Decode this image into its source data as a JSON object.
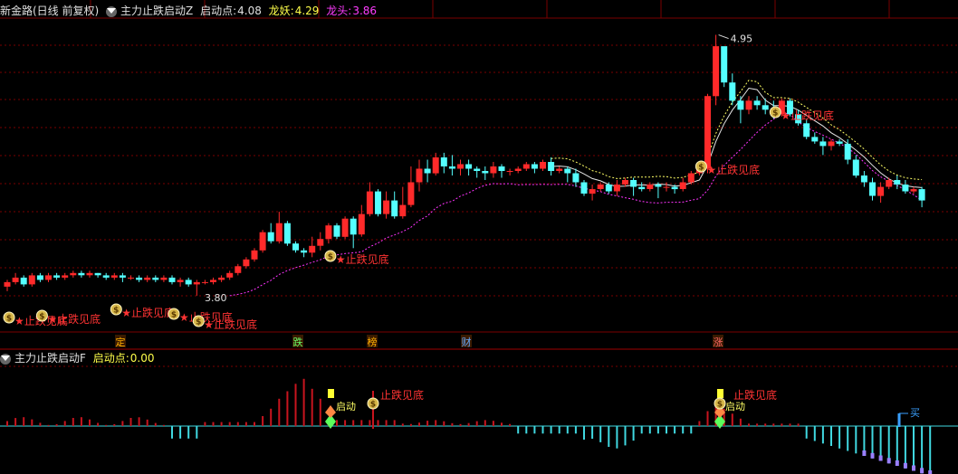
{
  "top_header": {
    "stock": "新金路(日线 前复权)",
    "indicator": "主力止跌启动Z",
    "qd_label": "启动点:",
    "qd_value": "4.08",
    "ly_label": "龙妖:",
    "ly_value": "4.29",
    "lt_label": "龙头:",
    "lt_value": "3.86"
  },
  "bottom_header": {
    "indicator": "主力止跌启动F",
    "qd_label": "启动点:",
    "qd_value": "0.00"
  },
  "price_labels": {
    "high": "4.95",
    "low": "3.80"
  },
  "event_tags": [
    "定",
    "跌",
    "榜",
    "财",
    "涨"
  ],
  "signal_labels": {
    "top": "★止跌见底",
    "bottom": "止跌见底",
    "start": "启动",
    "buy": "买"
  },
  "colors": {
    "up": "#ff2a2a",
    "down": "#54ffff",
    "ma_white": "#e6e6e6",
    "ma_yellow": "#ffff66",
    "ma_magenta": "#ff33ff",
    "grid": "#7a0000",
    "bar_red": "#c8141e",
    "bar_cyan": "#40d8e0",
    "bar_purple": "#9a80ff",
    "label_red": "#ff3333",
    "header_magenta": "#ff3cff",
    "header_yellow": "#ffff4a"
  },
  "chart_data": {
    "type": "candlestick",
    "ylim": [
      3.7,
      5.0
    ],
    "candles": [
      [
        3.84,
        3.86,
        3.82,
        3.87
      ],
      [
        3.86,
        3.88,
        3.85,
        3.9
      ],
      [
        3.88,
        3.85,
        3.84,
        3.89
      ],
      [
        3.85,
        3.89,
        3.84,
        3.9
      ],
      [
        3.89,
        3.87,
        3.86,
        3.9
      ],
      [
        3.87,
        3.89,
        3.86,
        3.9
      ],
      [
        3.89,
        3.88,
        3.87,
        3.9
      ],
      [
        3.88,
        3.89,
        3.87,
        3.9
      ],
      [
        3.89,
        3.9,
        3.88,
        3.91
      ],
      [
        3.9,
        3.89,
        3.88,
        3.91
      ],
      [
        3.89,
        3.9,
        3.88,
        3.91
      ],
      [
        3.9,
        3.89,
        3.88,
        3.9
      ],
      [
        3.89,
        3.88,
        3.87,
        3.9
      ],
      [
        3.88,
        3.89,
        3.87,
        3.9
      ],
      [
        3.89,
        3.88,
        3.86,
        3.9
      ],
      [
        3.88,
        3.88,
        3.87,
        3.89
      ],
      [
        3.88,
        3.87,
        3.86,
        3.89
      ],
      [
        3.87,
        3.88,
        3.86,
        3.89
      ],
      [
        3.88,
        3.87,
        3.86,
        3.89
      ],
      [
        3.87,
        3.88,
        3.86,
        3.89
      ],
      [
        3.88,
        3.86,
        3.85,
        3.89
      ],
      [
        3.86,
        3.87,
        3.84,
        3.88
      ],
      [
        3.87,
        3.85,
        3.84,
        3.88
      ],
      [
        3.85,
        3.86,
        3.8,
        3.87
      ],
      [
        3.86,
        3.86,
        3.85,
        3.87
      ],
      [
        3.86,
        3.87,
        3.85,
        3.88
      ],
      [
        3.87,
        3.88,
        3.86,
        3.89
      ],
      [
        3.88,
        3.9,
        3.87,
        3.91
      ],
      [
        3.9,
        3.93,
        3.89,
        3.94
      ],
      [
        3.93,
        3.96,
        3.92,
        3.97
      ],
      [
        3.96,
        4.0,
        3.95,
        4.01
      ],
      [
        4.0,
        4.08,
        3.99,
        4.09
      ],
      [
        4.08,
        4.04,
        4.03,
        4.12
      ],
      [
        4.04,
        4.12,
        4.03,
        4.17
      ],
      [
        4.12,
        4.03,
        4.02,
        4.13
      ],
      [
        4.03,
        4.0,
        3.99,
        4.04
      ],
      [
        4.0,
        3.99,
        3.97,
        4.01
      ],
      [
        3.99,
        4.02,
        3.97,
        4.06
      ],
      [
        4.02,
        4.05,
        4.0,
        4.08
      ],
      [
        4.05,
        4.11,
        4.03,
        4.12
      ],
      [
        4.11,
        4.06,
        4.05,
        4.12
      ],
      [
        4.06,
        4.14,
        4.05,
        4.15
      ],
      [
        4.14,
        4.07,
        4.01,
        4.15
      ],
      [
        4.07,
        4.16,
        4.06,
        4.2
      ],
      [
        4.16,
        4.26,
        4.15,
        4.3
      ],
      [
        4.26,
        4.16,
        4.15,
        4.27
      ],
      [
        4.16,
        4.22,
        4.14,
        4.26
      ],
      [
        4.22,
        4.15,
        4.14,
        4.26
      ],
      [
        4.15,
        4.2,
        4.14,
        4.28
      ],
      [
        4.2,
        4.3,
        4.19,
        4.37
      ],
      [
        4.3,
        4.36,
        4.26,
        4.4
      ],
      [
        4.36,
        4.34,
        4.3,
        4.4
      ],
      [
        4.34,
        4.41,
        4.33,
        4.43
      ],
      [
        4.41,
        4.37,
        4.34,
        4.43
      ],
      [
        4.37,
        4.36,
        4.33,
        4.42
      ],
      [
        4.36,
        4.38,
        4.33,
        4.4
      ],
      [
        4.38,
        4.36,
        4.33,
        4.4
      ],
      [
        4.36,
        4.35,
        4.32,
        4.37
      ],
      [
        4.35,
        4.34,
        4.31,
        4.37
      ],
      [
        4.34,
        4.37,
        4.32,
        4.39
      ],
      [
        4.37,
        4.35,
        4.32,
        4.38
      ],
      [
        4.35,
        4.35,
        4.33,
        4.36
      ],
      [
        4.35,
        4.36,
        4.34,
        4.37
      ],
      [
        4.36,
        4.38,
        4.35,
        4.39
      ],
      [
        4.38,
        4.36,
        4.34,
        4.39
      ],
      [
        4.36,
        4.39,
        4.35,
        4.4
      ],
      [
        4.39,
        4.35,
        4.33,
        4.41
      ],
      [
        4.35,
        4.36,
        4.34,
        4.37
      ],
      [
        4.36,
        4.34,
        4.3,
        4.37
      ],
      [
        4.34,
        4.3,
        4.28,
        4.36
      ],
      [
        4.3,
        4.25,
        4.24,
        4.31
      ],
      [
        4.25,
        4.27,
        4.22,
        4.29
      ],
      [
        4.27,
        4.29,
        4.26,
        4.3
      ],
      [
        4.29,
        4.26,
        4.25,
        4.3
      ],
      [
        4.26,
        4.29,
        4.24,
        4.31
      ],
      [
        4.29,
        4.31,
        4.28,
        4.32
      ],
      [
        4.31,
        4.28,
        4.24,
        4.32
      ],
      [
        4.28,
        4.27,
        4.26,
        4.3
      ],
      [
        4.27,
        4.29,
        4.26,
        4.3
      ],
      [
        4.29,
        4.28,
        4.23,
        4.3
      ],
      [
        4.28,
        4.28,
        4.26,
        4.3
      ],
      [
        4.28,
        4.27,
        4.25,
        4.29
      ],
      [
        4.27,
        4.3,
        4.26,
        4.32
      ],
      [
        4.3,
        4.34,
        4.29,
        4.35
      ],
      [
        4.34,
        4.36,
        4.33,
        4.37
      ],
      [
        4.36,
        4.68,
        4.34,
        4.69
      ],
      [
        4.68,
        4.9,
        4.64,
        4.95
      ],
      [
        4.9,
        4.74,
        4.72,
        4.82
      ],
      [
        4.74,
        4.66,
        4.64,
        4.78
      ],
      [
        4.66,
        4.62,
        4.56,
        4.68
      ],
      [
        4.62,
        4.66,
        4.6,
        4.68
      ],
      [
        4.66,
        4.64,
        4.62,
        4.68
      ],
      [
        4.64,
        4.62,
        4.6,
        4.67
      ],
      [
        4.62,
        4.6,
        4.58,
        4.66
      ],
      [
        4.6,
        4.66,
        4.59,
        4.67
      ],
      [
        4.66,
        4.6,
        4.59,
        4.67
      ],
      [
        4.6,
        4.56,
        4.55,
        4.62
      ],
      [
        4.56,
        4.5,
        4.49,
        4.58
      ],
      [
        4.5,
        4.48,
        4.47,
        4.52
      ],
      [
        4.48,
        4.46,
        4.42,
        4.5
      ],
      [
        4.46,
        4.48,
        4.44,
        4.49
      ],
      [
        4.48,
        4.47,
        4.46,
        4.49
      ],
      [
        4.47,
        4.4,
        4.38,
        4.49
      ],
      [
        4.4,
        4.33,
        4.32,
        4.42
      ],
      [
        4.33,
        4.3,
        4.28,
        4.35
      ],
      [
        4.3,
        4.24,
        4.22,
        4.32
      ],
      [
        4.24,
        4.28,
        4.21,
        4.3
      ],
      [
        4.28,
        4.31,
        4.27,
        4.32
      ],
      [
        4.31,
        4.29,
        4.27,
        4.33
      ],
      [
        4.29,
        4.26,
        4.25,
        4.31
      ],
      [
        4.26,
        4.27,
        4.25,
        4.28
      ],
      [
        4.27,
        4.22,
        4.19,
        4.28
      ]
    ]
  }
}
